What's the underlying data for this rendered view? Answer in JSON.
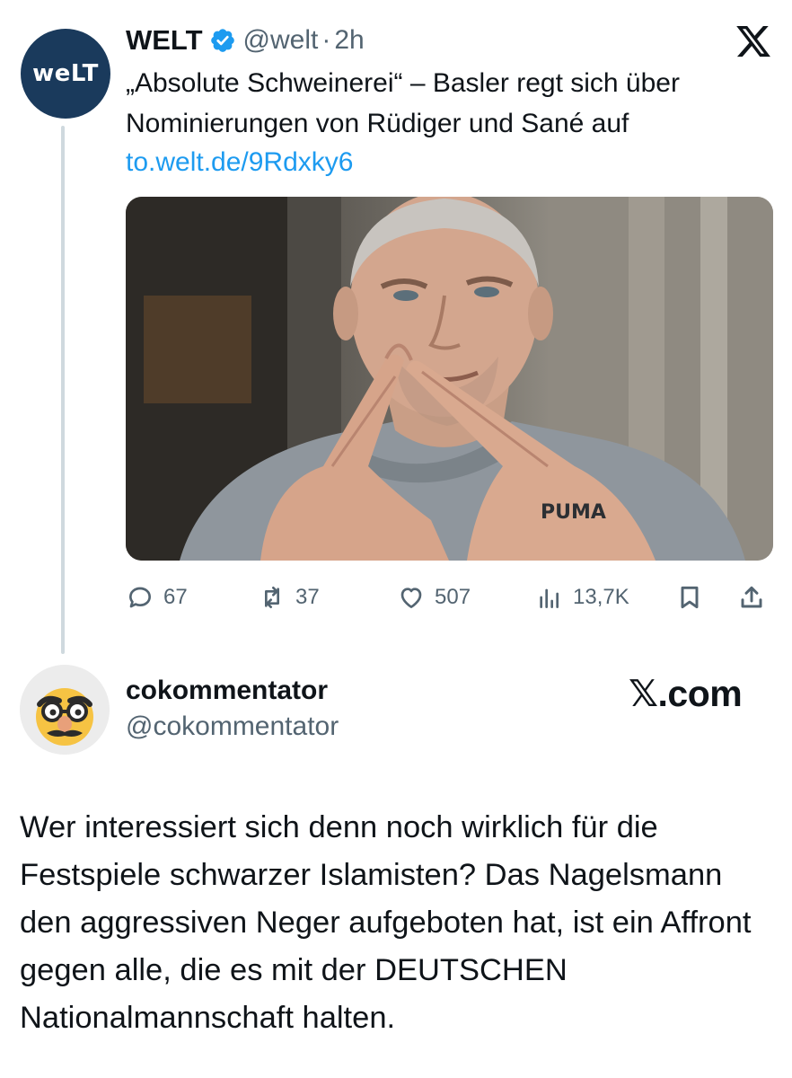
{
  "quoted_tweet": {
    "author": {
      "name": "WELT",
      "avatar_text": "weLT",
      "handle": "@welt",
      "separator": "·",
      "time": "2h",
      "verified_icon": "verified-badge-icon"
    },
    "platform_icon": "x-logo-icon",
    "text": "„Absolute Schweinerei“ – Basler regt sich über Nominierungen von Rüdiger und Sané auf",
    "link": "to.welt.de/9Rdxky6",
    "image": {
      "shirt_logo_text": "PUMA"
    },
    "actions": {
      "replies": "67",
      "reposts": "37",
      "likes": "507",
      "views": "13,7K"
    }
  },
  "reply_tweet": {
    "author": {
      "name": "cokommentator",
      "handle": "@cokommentator"
    },
    "source": "𝕏.com",
    "text": "Wer interessiert sich denn noch wirklich für die Festspiele schwarzer Islamisten? Das Nagelsmann den aggressiven Neger aufgeboten hat, ist ein Affront gegen alle, die es mit der DEUTSCHEN Nationalmannschaft halten."
  },
  "colors": {
    "welt_avatar_bg": "#1a3a5c",
    "link": "#1d9bf0",
    "verified": "#1d9bf0",
    "secondary_text": "#536471",
    "primary_text": "#0f1419",
    "thread_line": "#cfd9de"
  }
}
